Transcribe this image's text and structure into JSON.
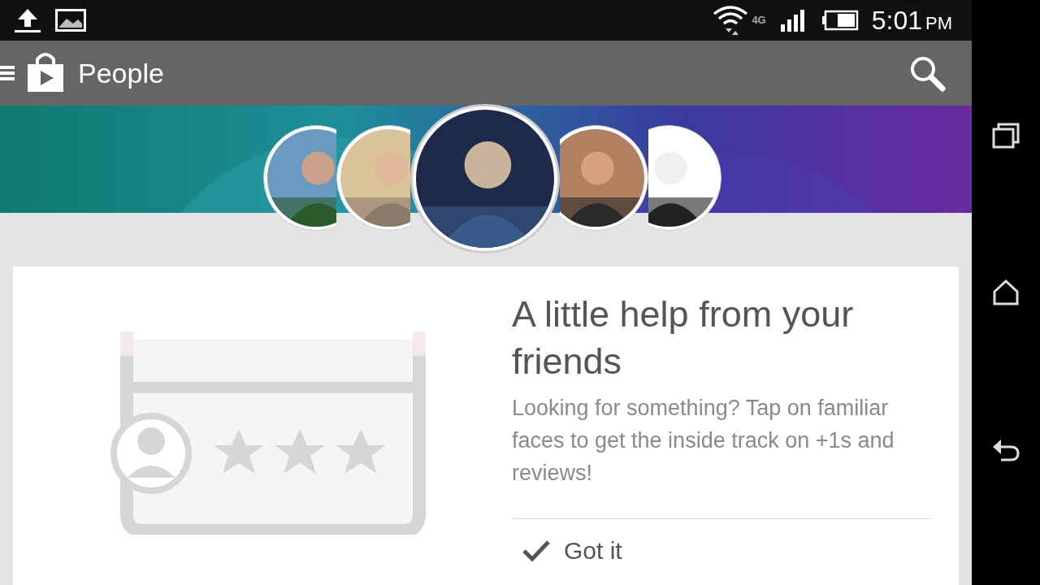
{
  "status_bar": {
    "network": "4G",
    "time": "5:01",
    "period": "PM"
  },
  "action_bar": {
    "title": "People"
  },
  "avatars": [
    {
      "selected": false
    },
    {
      "selected": false
    },
    {
      "selected": true
    },
    {
      "selected": false
    },
    {
      "selected": false
    }
  ],
  "card": {
    "title": "A little help from your friends",
    "body": "Looking for something? Tap on familiar faces to get the inside track on +1s and reviews!",
    "button": "Got it"
  }
}
